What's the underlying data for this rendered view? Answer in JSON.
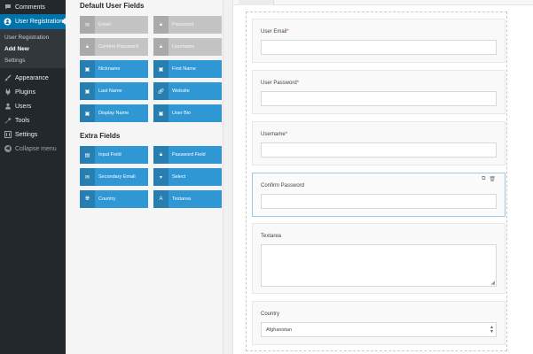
{
  "sidebar": {
    "items_top": [
      {
        "label": "Comments",
        "icon": "comment-icon"
      }
    ],
    "current": {
      "label": "User Registration",
      "icon": "user-registration-icon"
    },
    "submenu": [
      {
        "label": "User Registration",
        "active": false
      },
      {
        "label": "Add New",
        "active": true
      },
      {
        "label": "Settings",
        "active": false
      }
    ],
    "items_bottom": [
      {
        "label": "Appearance",
        "icon": "brush-icon"
      },
      {
        "label": "Plugins",
        "icon": "plugin-icon"
      },
      {
        "label": "Users",
        "icon": "users-icon"
      },
      {
        "label": "Tools",
        "icon": "wrench-icon"
      },
      {
        "label": "Settings",
        "icon": "settings-icon"
      }
    ],
    "collapse_label": "Collapse menu"
  },
  "palette": {
    "default_title": "Default User Fields",
    "default_fields": [
      {
        "label": "Email",
        "icon": "envelope-icon",
        "disabled": true
      },
      {
        "label": "Password",
        "icon": "lock-icon",
        "disabled": true
      },
      {
        "label": "Confirm Password",
        "icon": "lock-icon",
        "disabled": true
      },
      {
        "label": "Username",
        "icon": "lock-icon",
        "disabled": true
      },
      {
        "label": "Nickname",
        "icon": "id-card-icon",
        "disabled": false
      },
      {
        "label": "First Name",
        "icon": "id-card-icon",
        "disabled": false
      },
      {
        "label": "Last Name",
        "icon": "id-card-icon",
        "disabled": false
      },
      {
        "label": "Website",
        "icon": "link-icon",
        "disabled": false
      },
      {
        "label": "Display Name",
        "icon": "id-card-icon",
        "disabled": false
      },
      {
        "label": "User Bio",
        "icon": "id-card-icon",
        "disabled": false
      }
    ],
    "extra_title": "Extra Fields",
    "extra_fields": [
      {
        "label": "Input Field",
        "icon": "text-field-icon",
        "disabled": false
      },
      {
        "label": "Password Field",
        "icon": "lock-icon",
        "disabled": false
      },
      {
        "label": "Secondary Email",
        "icon": "envelope-icon",
        "disabled": false
      },
      {
        "label": "Select",
        "icon": "select-icon",
        "disabled": false
      },
      {
        "label": "Country",
        "icon": "globe-icon",
        "disabled": false
      },
      {
        "label": "Textarea",
        "icon": "textarea-icon",
        "disabled": false
      }
    ]
  },
  "form": {
    "rows": [
      {
        "label": "User Email",
        "required": true,
        "type": "input"
      },
      {
        "label": "User Password",
        "required": true,
        "type": "input"
      },
      {
        "label": "Username",
        "required": true,
        "type": "input"
      },
      {
        "label": "Confirm Password",
        "required": false,
        "type": "input",
        "selected": true
      },
      {
        "label": "Textarea",
        "required": false,
        "type": "textarea"
      },
      {
        "label": "Country",
        "required": false,
        "type": "select",
        "value": "Afghanistan"
      }
    ],
    "required_mark": "*"
  },
  "colors": {
    "sidebar_bg": "#23282d",
    "accent": "#0073aa",
    "field_button": "#2f97d3",
    "field_button_disabled": "#c4c4c4"
  }
}
